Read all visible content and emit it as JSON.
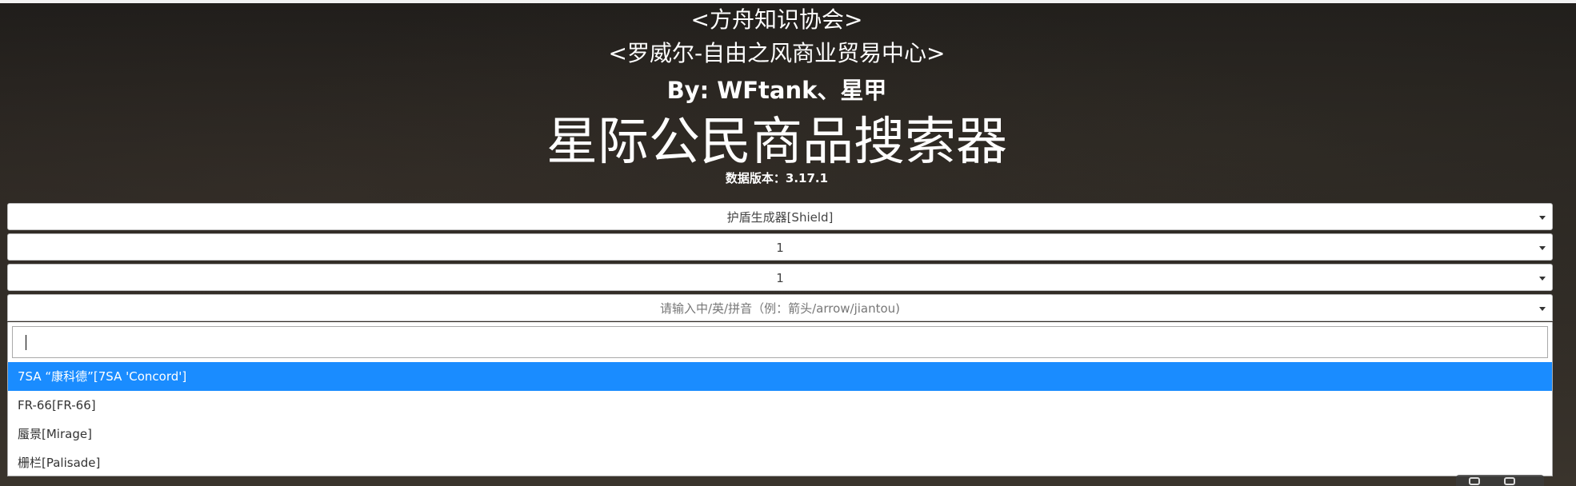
{
  "header": {
    "line1": "<方舟知识协会>",
    "line2": "<罗威尔-自由之风商业贸易中心>",
    "line3": "By: WFtank、星甲",
    "title": "星际公民商品搜索器",
    "version_label": "数据版本：",
    "version_value": "3.17.1"
  },
  "selects": {
    "category": "护盾生成器[Shield]",
    "size": "1",
    "grade": "1",
    "item_placeholder": "请输入中/英/拼音（例：箭头/arrow/jiantou)"
  },
  "dropdown": {
    "search_value": "",
    "options": [
      "7SA “康科德”[7SA 'Concord']",
      "FR-66[FR-66]",
      "蜃景[Mirage]",
      "栅栏[Palisade]"
    ],
    "highlighted_index": 0
  },
  "icons": {
    "select_arrow": "caret-down-icon",
    "corner_a": "eye-icon",
    "corner_b": "list-icon"
  },
  "colors": {
    "highlight": "#1a8cff"
  }
}
